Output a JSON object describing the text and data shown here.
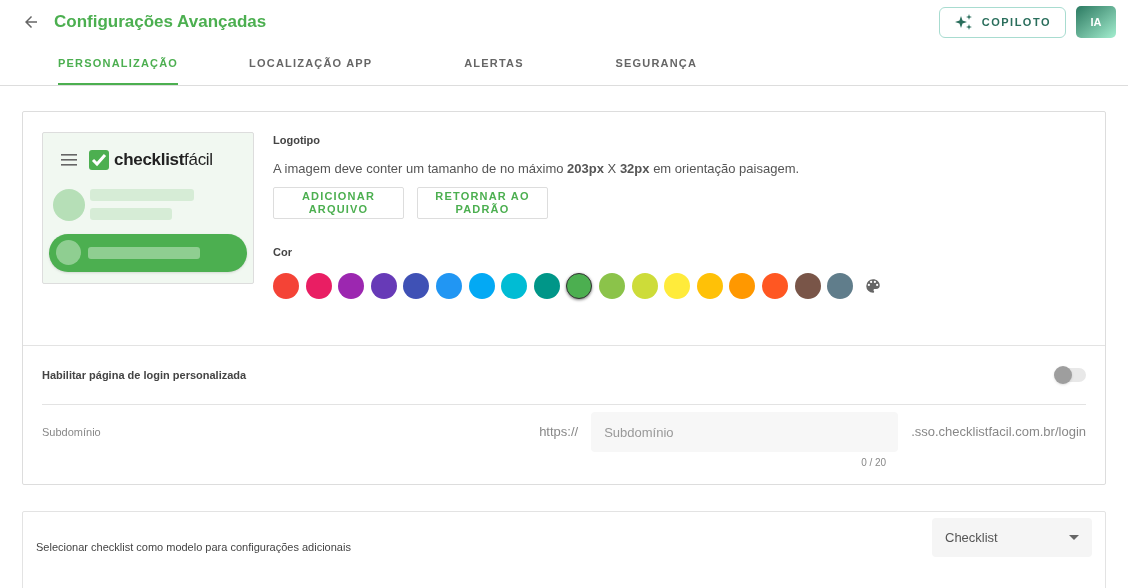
{
  "header": {
    "title": "Configurações Avançadas",
    "copilot_button": "COPILOTO",
    "avatar": "IA"
  },
  "tabs": [
    {
      "label": "PERSONALIZAÇÃO",
      "selected": true
    },
    {
      "label": "LOCALIZAÇÃO APP",
      "selected": false
    },
    {
      "label": "ALERTAS",
      "selected": false
    },
    {
      "label": "SEGURANÇA",
      "selected": false
    }
  ],
  "logo_preview": {
    "logo_text": "**checklist**fácil"
  },
  "logo": {
    "label": "Logotipo",
    "description": "A imagem deve conter um tamanho de no máximo **203px** X **32px** em orientação paisagem.",
    "buttons": [
      "ADICIONAR ARQUIVO",
      "RETORNAR AO PADRÃO"
    ]
  },
  "color": {
    "label": "Cor",
    "swatches": [
      {
        "color": "#f44336",
        "selected": false
      },
      {
        "color": "#e91e63",
        "selected": false
      },
      {
        "color": "#9c27b0",
        "selected": false
      },
      {
        "color": "#673ab7",
        "selected": false
      },
      {
        "color": "#3f51b5",
        "selected": false
      },
      {
        "color": "#2196f3",
        "selected": false
      },
      {
        "color": "#03a9f4",
        "selected": false
      },
      {
        "color": "#00bcd4",
        "selected": false
      },
      {
        "color": "#009688",
        "selected": false
      },
      {
        "color": "#4caf50",
        "selected": true
      },
      {
        "color": "#8bc34a",
        "selected": false
      },
      {
        "color": "#cddc39",
        "selected": false
      },
      {
        "color": "#ffeb3b",
        "selected": false
      },
      {
        "color": "#ffc107",
        "selected": false
      },
      {
        "color": "#ff9800",
        "selected": false
      },
      {
        "color": "#ff5722",
        "selected": false
      },
      {
        "color": "#795548",
        "selected": false
      },
      {
        "color": "#607d8b",
        "selected": false
      }
    ]
  },
  "custom_login": {
    "label": "Habilitar página de login personalizada",
    "on": false
  },
  "subdomain": {
    "label": "Subdomínio",
    "prefix": "https://",
    "placeholder": "Subdomínio",
    "counter": "0 / 20",
    "suffix": ".sso.checklistfacil.com.br/login"
  },
  "template": {
    "label": "Selecionar checklist como modelo para configurações adicionais",
    "select_value": "Checklist"
  }
}
